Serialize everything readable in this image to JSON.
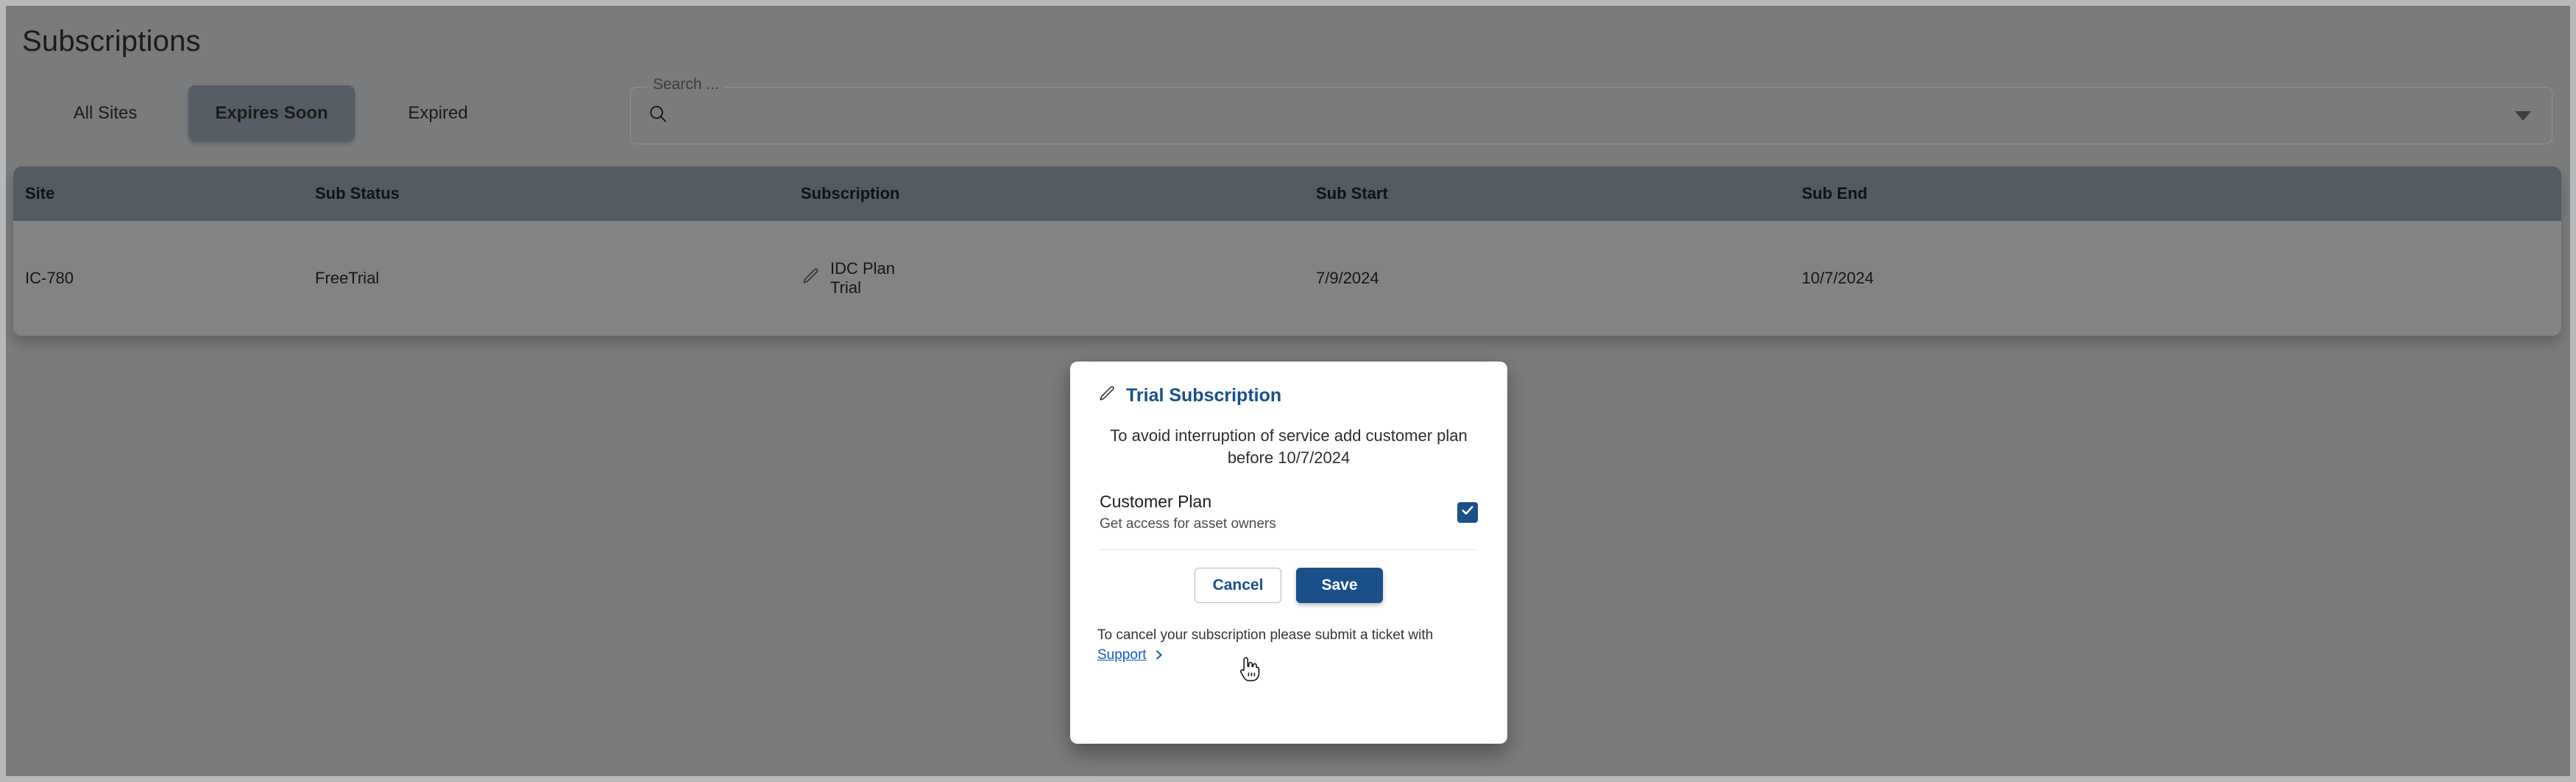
{
  "page": {
    "title": "Subscriptions"
  },
  "tabs": [
    {
      "label": "All Sites",
      "active": false
    },
    {
      "label": "Expires Soon",
      "active": true
    },
    {
      "label": "Expired",
      "active": false
    }
  ],
  "search": {
    "legend": "Search ...",
    "value": "",
    "placeholder": "",
    "icon": "search-icon",
    "dropdown_icon": "chevron-down-icon"
  },
  "table": {
    "columns": [
      "Site",
      "Sub Status",
      "Subscription",
      "Sub Start",
      "Sub End"
    ],
    "rows": [
      {
        "site": "IC-780",
        "sub_status": "FreeTrial",
        "subscription_icon": "pencil-icon",
        "subscription_plan": "IDC Plan",
        "subscription_tier": "Trial",
        "sub_start": "7/9/2024",
        "sub_end": "10/7/2024"
      }
    ]
  },
  "modal": {
    "icon": "pencil-icon",
    "title": "Trial Subscription",
    "message": "To avoid interruption of service add customer plan before 10/7/2024",
    "option": {
      "name": "Customer Plan",
      "description": "Get access for asset owners",
      "checked": true,
      "check_icon": "checkmark-icon"
    },
    "cancel_label": "Cancel",
    "save_label": "Save",
    "footer_text": "To cancel your subscription please submit a ticket with",
    "support_label": "Support",
    "support_chevron_icon": "chevron-right-icon"
  },
  "colors": {
    "brand_blue": "#1a5089",
    "link_blue": "#1658c4",
    "table_header": "#545b61",
    "table_row": "#828385",
    "active_tab": "#565d64"
  },
  "cursor": {
    "icon": "pointing-hand-cursor"
  }
}
